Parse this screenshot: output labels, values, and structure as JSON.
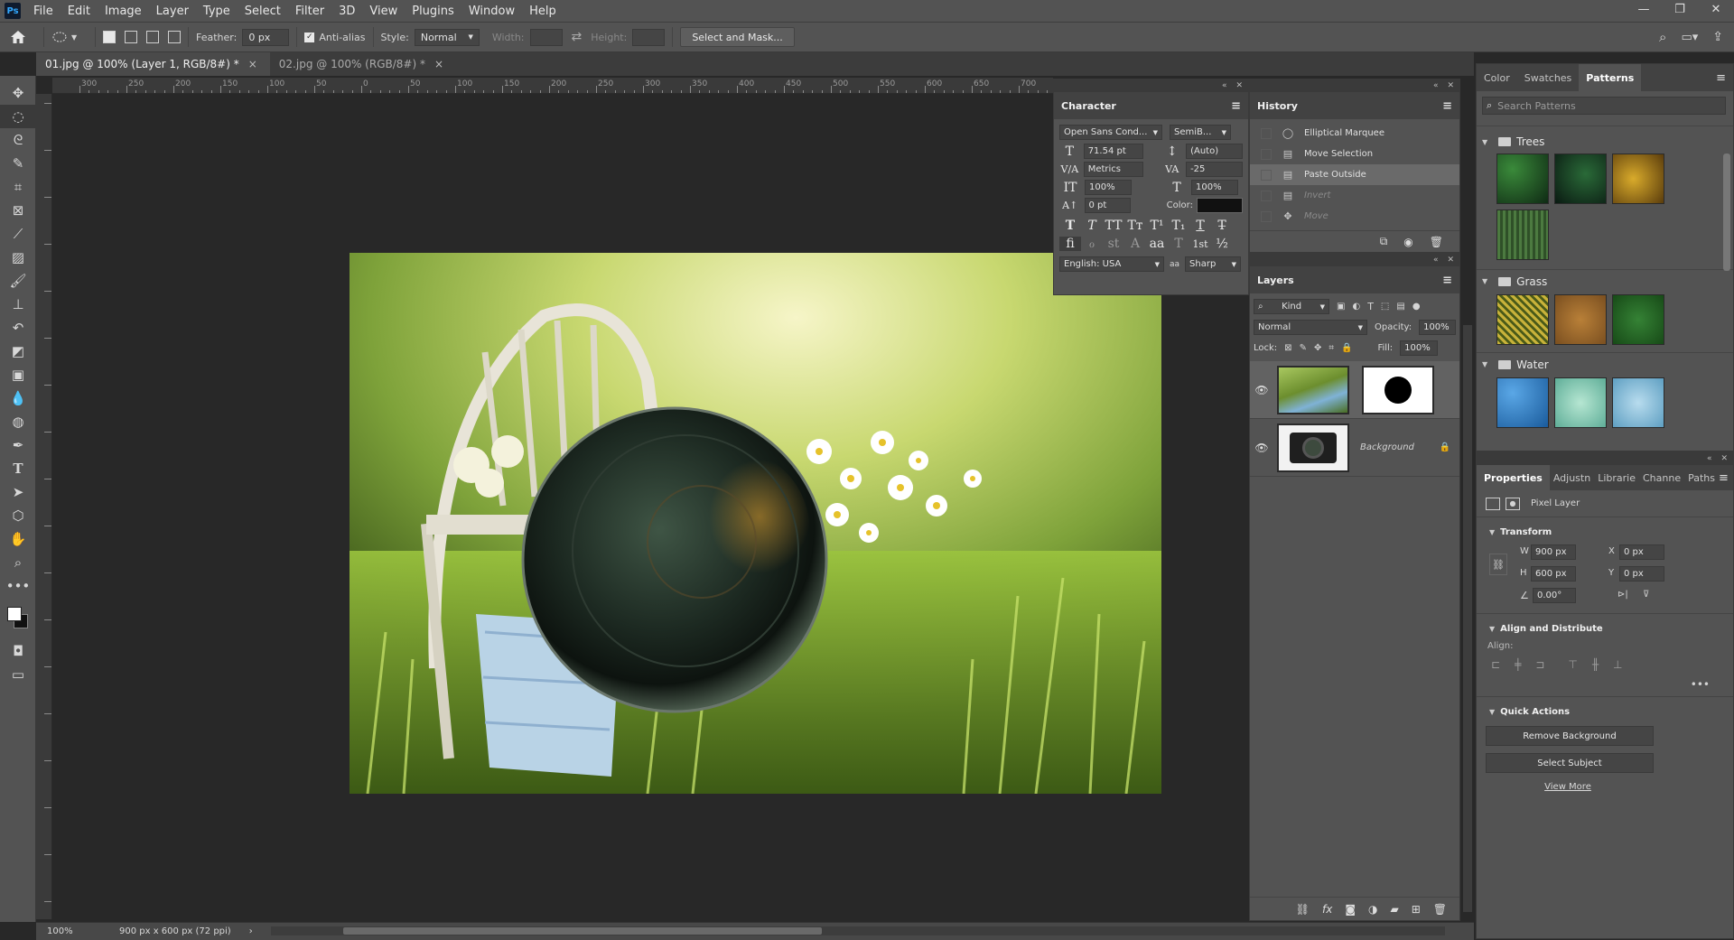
{
  "app": {
    "logo": "Ps"
  },
  "menu": [
    "File",
    "Edit",
    "Image",
    "Layer",
    "Type",
    "Select",
    "Filter",
    "3D",
    "View",
    "Plugins",
    "Window",
    "Help"
  ],
  "window_controls": [
    "—",
    "❐",
    "✕"
  ],
  "options": {
    "feather_label": "Feather:",
    "feather_value": "0 px",
    "antialias_label": "Anti-alias",
    "style_label": "Style:",
    "style_value": "Normal",
    "width_label": "Width:",
    "height_label": "Height:",
    "select_mask": "Select and Mask..."
  },
  "tabs": [
    {
      "label": "01.jpg @ 100% (Layer 1, RGB/8#) *",
      "close": "×"
    },
    {
      "label": "02.jpg @ 100% (RGB/8#) *",
      "close": "×"
    }
  ],
  "ruler_labels": [
    "300",
    "250",
    "200",
    "150",
    "100",
    "50",
    "0",
    "50",
    "100",
    "150",
    "200",
    "250",
    "300",
    "350",
    "400",
    "450",
    "500",
    "550",
    "600",
    "650",
    "700",
    "750"
  ],
  "character": {
    "title": "Character",
    "font_family": "Open Sans Cond...",
    "font_style": "SemiB...",
    "size": "71.54 pt",
    "leading": "(Auto)",
    "kerning": "Metrics",
    "tracking": "-25",
    "vscale": "100%",
    "hscale": "100%",
    "baseline": "0 pt",
    "color_label": "Color:",
    "language": "English: USA",
    "aa_label": "aa",
    "antialias": "Sharp",
    "glyphs_row1": [
      "T",
      "T",
      "TT",
      "Tт",
      "T¹",
      "T₁",
      "T",
      "T̶"
    ],
    "glyphs_row2": [
      "fi",
      "ℴ",
      "st",
      "A",
      "aa",
      "T",
      "1st",
      "½"
    ]
  },
  "history": {
    "title": "History",
    "items": [
      {
        "icon": "◯",
        "label": "Elliptical Marquee"
      },
      {
        "icon": "▤",
        "label": "Move Selection"
      },
      {
        "icon": "▤",
        "label": "Paste Outside"
      },
      {
        "icon": "▤",
        "label": "Invert"
      },
      {
        "icon": "✥",
        "label": "Move"
      }
    ]
  },
  "layers": {
    "title": "Layers",
    "kind_label": "Kind",
    "blend_mode": "Normal",
    "opacity_label": "Opacity:",
    "opacity_value": "100%",
    "lock_label": "Lock:",
    "fill_label": "Fill:",
    "fill_value": "100%",
    "items": [
      {
        "name": ""
      },
      {
        "name": "Background"
      }
    ]
  },
  "patterns_panel": {
    "tabs": [
      "Color",
      "Swatches",
      "Patterns"
    ],
    "search_placeholder": "Search Patterns",
    "groups": [
      "Trees",
      "Grass",
      "Water"
    ],
    "colors": {
      "trees": [
        "#1f4a22",
        "#13301f",
        "#b0861a",
        "#3f6a35"
      ],
      "grass": [
        "#b39a2c",
        "#a36f30",
        "#2b6c2b"
      ],
      "water": [
        "#2d7dbf",
        "#7ec4b0",
        "#7fb5cf"
      ]
    }
  },
  "properties": {
    "tabs": [
      "Properties",
      "Adjustn",
      "Librarie",
      "Channe",
      "Paths"
    ],
    "type": "Pixel Layer",
    "transform": "Transform",
    "w_label": "W",
    "w": "900 px",
    "h_label": "H",
    "h": "600 px",
    "x_label": "X",
    "x": "0 px",
    "y_label": "Y",
    "y": "0 px",
    "angle": "0.00°",
    "align_section": "Align and Distribute",
    "align_label": "Align:",
    "quick_actions": "Quick Actions",
    "remove_bg": "Remove Background",
    "select_subject": "Select Subject",
    "view_more": "View More"
  },
  "status": {
    "zoom": "100%",
    "doc": "900 px x 600 px (72 ppi)"
  }
}
